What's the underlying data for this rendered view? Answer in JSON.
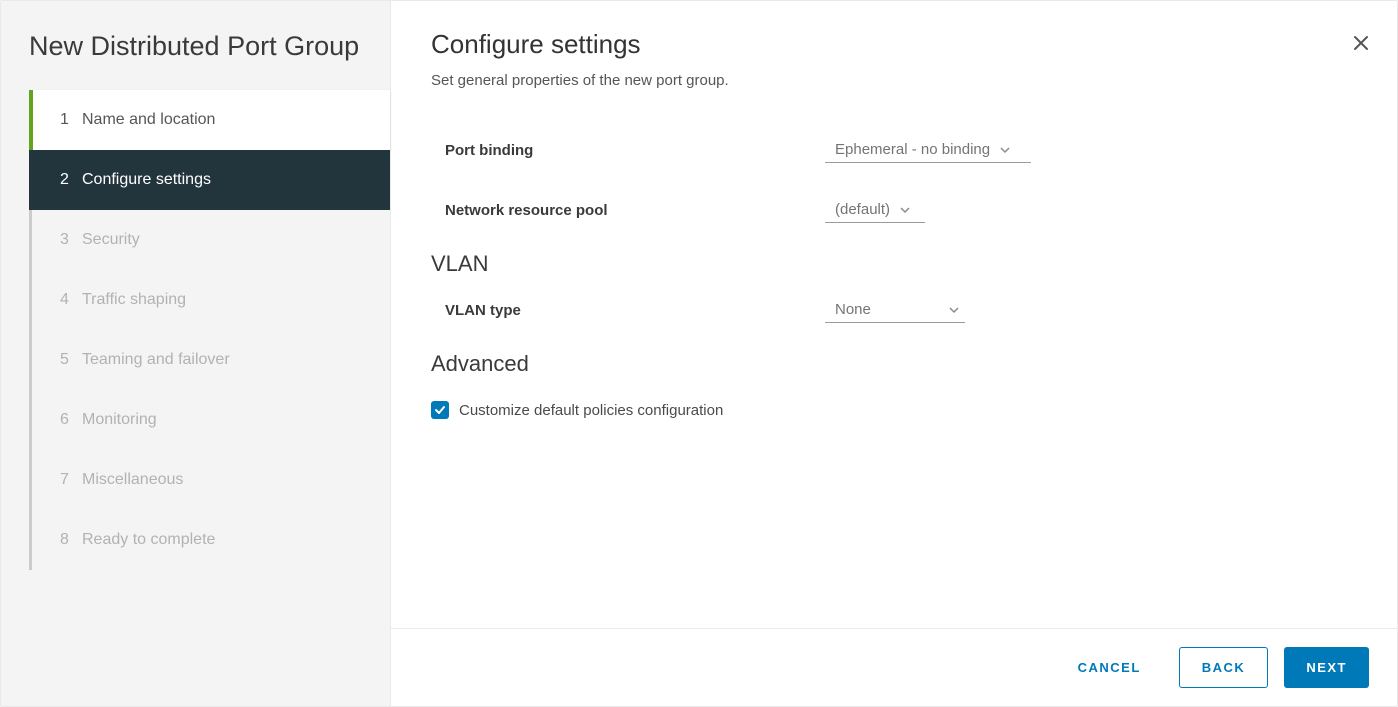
{
  "wizard": {
    "title": "New Distributed Port Group",
    "steps": [
      {
        "num": "1",
        "label": "Name and location",
        "state": "completed"
      },
      {
        "num": "2",
        "label": "Configure settings",
        "state": "active"
      },
      {
        "num": "3",
        "label": "Security",
        "state": "pending"
      },
      {
        "num": "4",
        "label": "Traffic shaping",
        "state": "pending"
      },
      {
        "num": "5",
        "label": "Teaming and failover",
        "state": "pending"
      },
      {
        "num": "6",
        "label": "Monitoring",
        "state": "pending"
      },
      {
        "num": "7",
        "label": "Miscellaneous",
        "state": "pending"
      },
      {
        "num": "8",
        "label": "Ready to complete",
        "state": "pending"
      }
    ]
  },
  "page": {
    "title": "Configure settings",
    "subtext": "Set general properties of the new port group.",
    "labels": {
      "port_binding": "Port binding",
      "network_resource_pool": "Network resource pool",
      "vlan_heading": "VLAN",
      "vlan_type": "VLAN type",
      "advanced_heading": "Advanced",
      "customize_checkbox": "Customize default policies configuration"
    },
    "values": {
      "port_binding": "Ephemeral - no binding",
      "network_resource_pool": "(default)",
      "vlan_type": "None",
      "customize_checked": true
    }
  },
  "footer": {
    "cancel": "CANCEL",
    "back": "BACK",
    "next": "NEXT"
  },
  "colors": {
    "primary": "#0079b8",
    "sidebar_active": "#22343c",
    "completed_accent": "#62a420"
  }
}
